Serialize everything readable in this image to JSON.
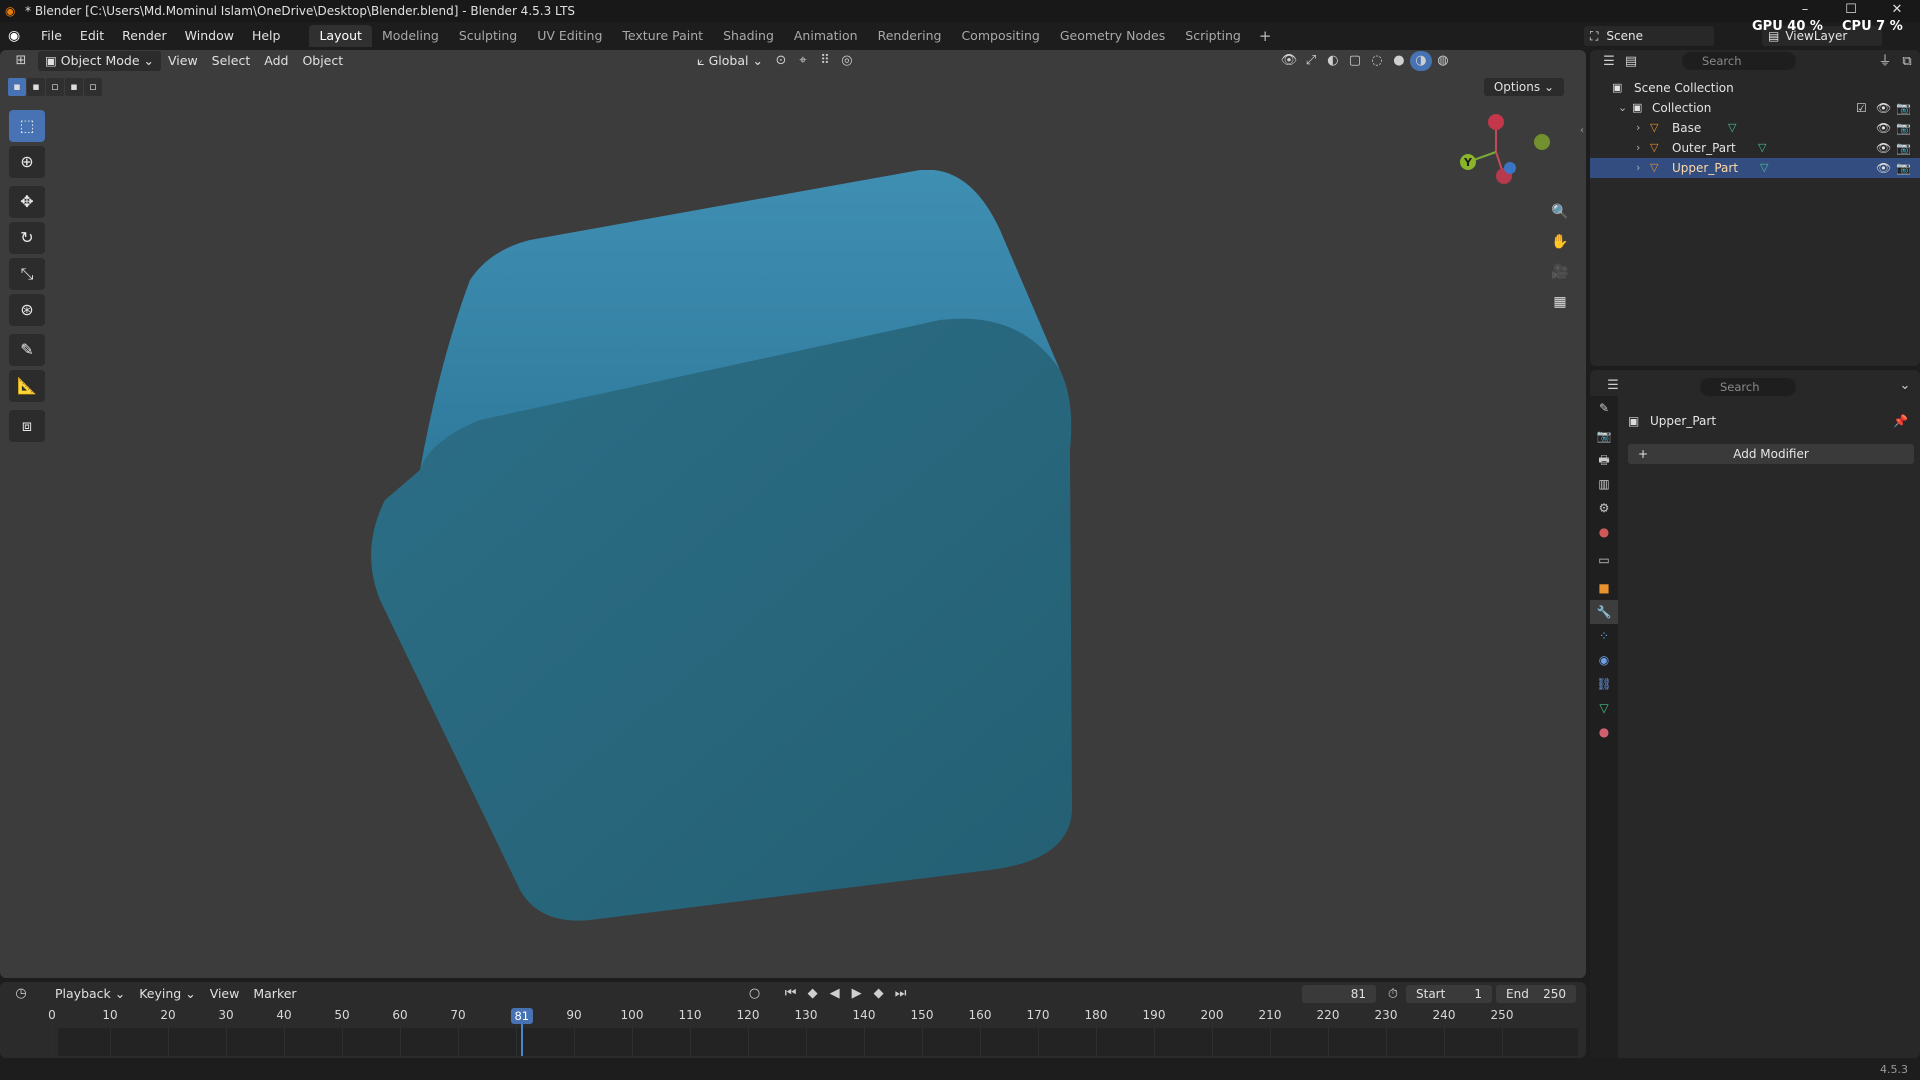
{
  "window": {
    "title": "* Blender [C:\\Users\\Md.Mominul Islam\\OneDrive\\Desktop\\Blender.blend] - Blender 4.5.3 LTS",
    "controls": [
      "–",
      "☐",
      "✕"
    ]
  },
  "menu": [
    "File",
    "Edit",
    "Render",
    "Window",
    "Help"
  ],
  "workspaces": {
    "tabs": [
      "Layout",
      "Modeling",
      "Sculpting",
      "UV Editing",
      "Texture Paint",
      "Shading",
      "Animation",
      "Rendering",
      "Compositing",
      "Geometry Nodes",
      "Scripting"
    ],
    "active": "Layout",
    "add": "+"
  },
  "scene": {
    "label": "Scene",
    "view_layer": "ViewLayer"
  },
  "perf": {
    "gpu_label": "GPU",
    "gpu_value": "40 %",
    "cpu_label": "CPU",
    "cpu_value": "7 %"
  },
  "viewport": {
    "mode": "Object Mode",
    "menus": [
      "View",
      "Select",
      "Add",
      "Object"
    ],
    "transform_orientation": "Global",
    "options": "Options",
    "object_color": "#2f6f8a",
    "axes": {
      "y": "Y"
    }
  },
  "timeline": {
    "menus": [
      "Playback",
      "Keying",
      "View",
      "Marker"
    ],
    "current_frame": 81,
    "current_frame_label": "81",
    "start_label": "Start",
    "start": "1",
    "end_label": "End",
    "end": "250",
    "ticks": [
      "0",
      "10",
      "20",
      "30",
      "40",
      "50",
      "60",
      "70",
      "80",
      "90",
      "100",
      "110",
      "120",
      "130",
      "140",
      "150",
      "160",
      "170",
      "180",
      "190",
      "200",
      "210",
      "220",
      "230",
      "240",
      "250"
    ]
  },
  "outliner": {
    "search_placeholder": "Search",
    "root": "Scene Collection",
    "collection": "Collection",
    "items": [
      {
        "name": "Base",
        "selected": false
      },
      {
        "name": "Outer_Part",
        "selected": false
      },
      {
        "name": "Upper_Part",
        "selected": true
      }
    ]
  },
  "properties": {
    "search_placeholder": "Search",
    "object_name": "Upper_Part",
    "add_modifier": "Add Modifier",
    "active_tab": "modifier-icon"
  },
  "status": {
    "version": "4.5.3"
  }
}
